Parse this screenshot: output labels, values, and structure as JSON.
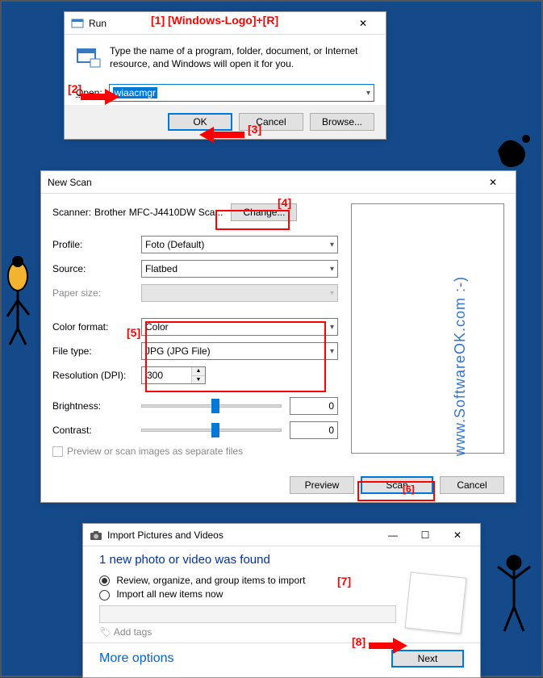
{
  "annotations": {
    "a1": "[1]  [Windows-Logo]+[R]",
    "a2": "[2]",
    "a3": "[3]",
    "a4": "[4]",
    "a5": "[5]",
    "a6": "[6]",
    "a7": "[7]",
    "a8": "[8]"
  },
  "run": {
    "title": "Run",
    "desc": "Type the name of a program, folder, document, or Internet resource, and Windows will open it for you.",
    "open_label": "Open:",
    "open_value": "wiaacmgr",
    "ok": "OK",
    "cancel": "Cancel",
    "browse": "Browse..."
  },
  "scan": {
    "title": "New Scan",
    "scanner_label": "Scanner:",
    "scanner_value": "Brother MFC-J4410DW Sca...",
    "change": "Change...",
    "profile_label": "Profile:",
    "profile_value": "Foto (Default)",
    "source_label": "Source:",
    "source_value": "Flatbed",
    "papersize_label": "Paper size:",
    "papersize_value": "",
    "colorformat_label": "Color format:",
    "colorformat_value": "Color",
    "filetype_label": "File type:",
    "filetype_value": "JPG (JPG File)",
    "resolution_label": "Resolution (DPI):",
    "resolution_value": "300",
    "brightness_label": "Brightness:",
    "brightness_value": "0",
    "contrast_label": "Contrast:",
    "contrast_value": "0",
    "preview_check": "Preview or scan images as separate files",
    "btn_preview": "Preview",
    "btn_scan": "Scan",
    "btn_cancel": "Cancel"
  },
  "import": {
    "title": "Import Pictures and Videos",
    "heading": "1 new photo or video was found",
    "radio1": "Review, organize, and group items to import",
    "radio2": "Import all new items now",
    "addtags": "Add tags",
    "more": "More options",
    "next": "Next"
  },
  "watermark": "www.SoftwareOK.com :-)"
}
